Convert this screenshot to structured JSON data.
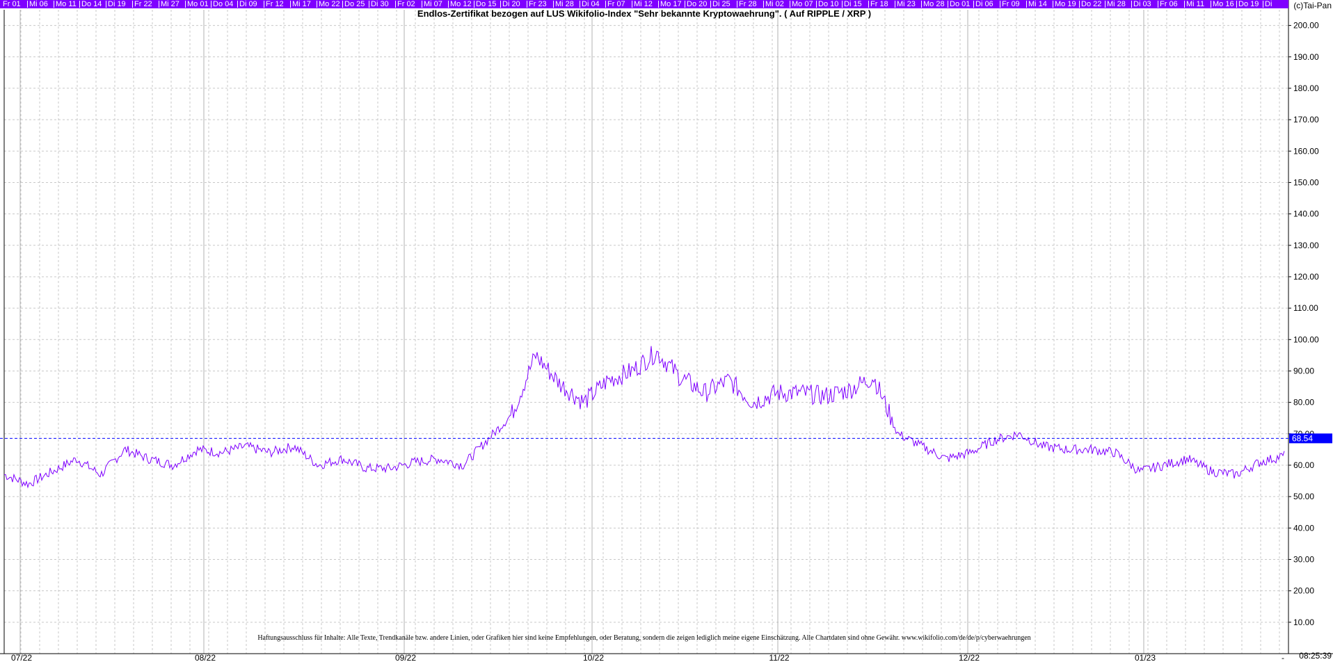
{
  "header": {
    "title": "Endlos-Zertifikat bezogen auf LUS Wikifolio-Index \"Sehr bekannte Kryptowaehrung\". ( Auf RIPPLE / XRP )",
    "copyright": "(c)Tai-Pan"
  },
  "date_strip": [
    "Fr 01",
    "Mi 06",
    "Mo 11",
    "Do 14",
    "Di 19",
    "Fr 22",
    "Mi 27",
    "Mo 01",
    "Do 04",
    "Di 09",
    "Fr 12",
    "Mi 17",
    "Mo 22",
    "Do 25",
    "Di 30",
    "Fr 02",
    "Mi 07",
    "Mo 12",
    "Do 15",
    "Di 20",
    "Fr 23",
    "Mi 28",
    "Di 04",
    "Fr 07",
    "Mi 12",
    "Mo 17",
    "Do 20",
    "Di 25",
    "Fr 28",
    "Mi 02",
    "Mo 07",
    "Do 10",
    "Di 15",
    "Fr 18",
    "Mi 23",
    "Mo 28",
    "Do 01",
    "Di 06",
    "Fr 09",
    "Mi 14",
    "Mo 19",
    "Do 22",
    "Mi 28",
    "Di 03",
    "Fr 06",
    "Mi 11",
    "Mo 16",
    "Do 19",
    "Di"
  ],
  "footer": {
    "disclaimer": "Haftungsausschluss für Inhalte: Alle Texte, Trendkanäle bzw. andere Linien, oder Grafiken hier sind keine Empfehlungen, oder Beratung, sondern die zeigen lediglich meine eigene Einschätzung. Alle Chartdaten sind ohne Gewähr. www.wikifolio.com/de/de/p/cyberwaehrungen",
    "timestamp": "08:25:39",
    "dash": "-"
  },
  "colors": {
    "line": "#7f00ff",
    "strip": "#7f00ff",
    "current": "#0000ff",
    "grid": "#c8c8c8"
  },
  "chart_data": {
    "type": "line",
    "title": "Endlos-Zertifikat bezogen auf LUS Wikifolio-Index \"Sehr bekannte Kryptowaehrung\". ( Auf RIPPLE / XRP )",
    "ylim": [
      0,
      205
    ],
    "y_ticks": [
      "10.00",
      "20.00",
      "30.00",
      "40.00",
      "50.00",
      "60.00",
      "70.00",
      "80.00",
      "90.00",
      "100.00",
      "110.00",
      "120.00",
      "130.00",
      "140.00",
      "150.00",
      "160.00",
      "170.00",
      "180.00",
      "190.00",
      "200.00"
    ],
    "x_ticks": [
      "07/22",
      "08/22",
      "09/22",
      "10/22",
      "11/22",
      "12/22",
      "01/23"
    ],
    "current_value": 68.54,
    "current_label": "68.54",
    "series": [
      {
        "x": [
          "07/01",
          "07/05",
          "07/10",
          "07/15",
          "07/20",
          "07/25",
          "07/30",
          "08/04",
          "08/09",
          "08/14",
          "08/19",
          "08/24",
          "08/29",
          "09/02",
          "09/07",
          "09/12",
          "09/17",
          "09/22",
          "09/27",
          "10/01",
          "10/05",
          "10/08",
          "10/10",
          "10/13",
          "10/16",
          "10/20",
          "10/23",
          "10/25",
          "10/28",
          "10/31",
          "11/02",
          "11/05",
          "11/08",
          "11/11",
          "11/14",
          "11/17",
          "11/20",
          "11/23",
          "11/26",
          "11/29",
          "12/02",
          "12/06",
          "12/10",
          "12/14",
          "12/18",
          "12/22",
          "12/26",
          "12/30",
          "01/03",
          "01/07",
          "01/11",
          "01/15",
          "01/19",
          "01/22"
        ],
        "values": [
          57,
          54,
          58,
          62,
          57,
          65,
          62,
          60,
          65,
          64,
          66,
          64,
          66,
          60,
          62,
          59,
          59,
          61,
          62,
          60,
          68,
          76,
          95,
          86,
          80,
          87,
          90,
          96,
          88,
          83,
          87,
          80,
          83,
          83,
          82,
          84,
          88,
          70,
          66,
          62,
          64,
          68,
          70,
          66,
          65,
          65,
          64,
          58,
          60,
          62,
          58,
          57,
          61,
          63
        ]
      }
    ]
  }
}
